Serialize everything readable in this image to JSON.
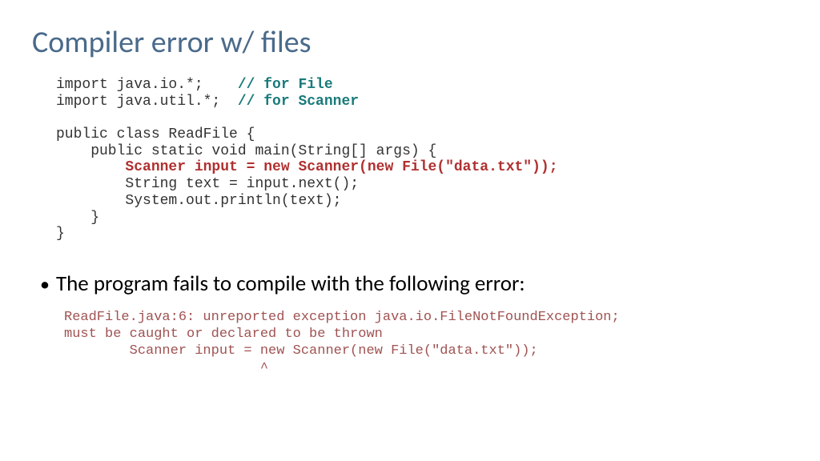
{
  "title": "Compiler error w/ files",
  "code": {
    "line1a": "import java.io.*;    ",
    "line1b": "// for File",
    "line2a": "import java.util.*;  ",
    "line2b": "// for Scanner",
    "line3": "",
    "line4": "public class ReadFile {",
    "line5": "    public static void main(String[] args) {",
    "line6": "        Scanner input = new Scanner(new File(\"data.txt\"));",
    "line7": "        String text = input.next();",
    "line8": "        System.out.println(text);",
    "line9": "    }",
    "line10": "}"
  },
  "bullet": "The program fails to compile with the following error:",
  "error": {
    "line1": "ReadFile.java:6: unreported exception java.io.FileNotFoundException;",
    "line2": "must be caught or declared to be thrown",
    "line3": "        Scanner input = new Scanner(new File(\"data.txt\"));",
    "line4": "                        ^"
  }
}
